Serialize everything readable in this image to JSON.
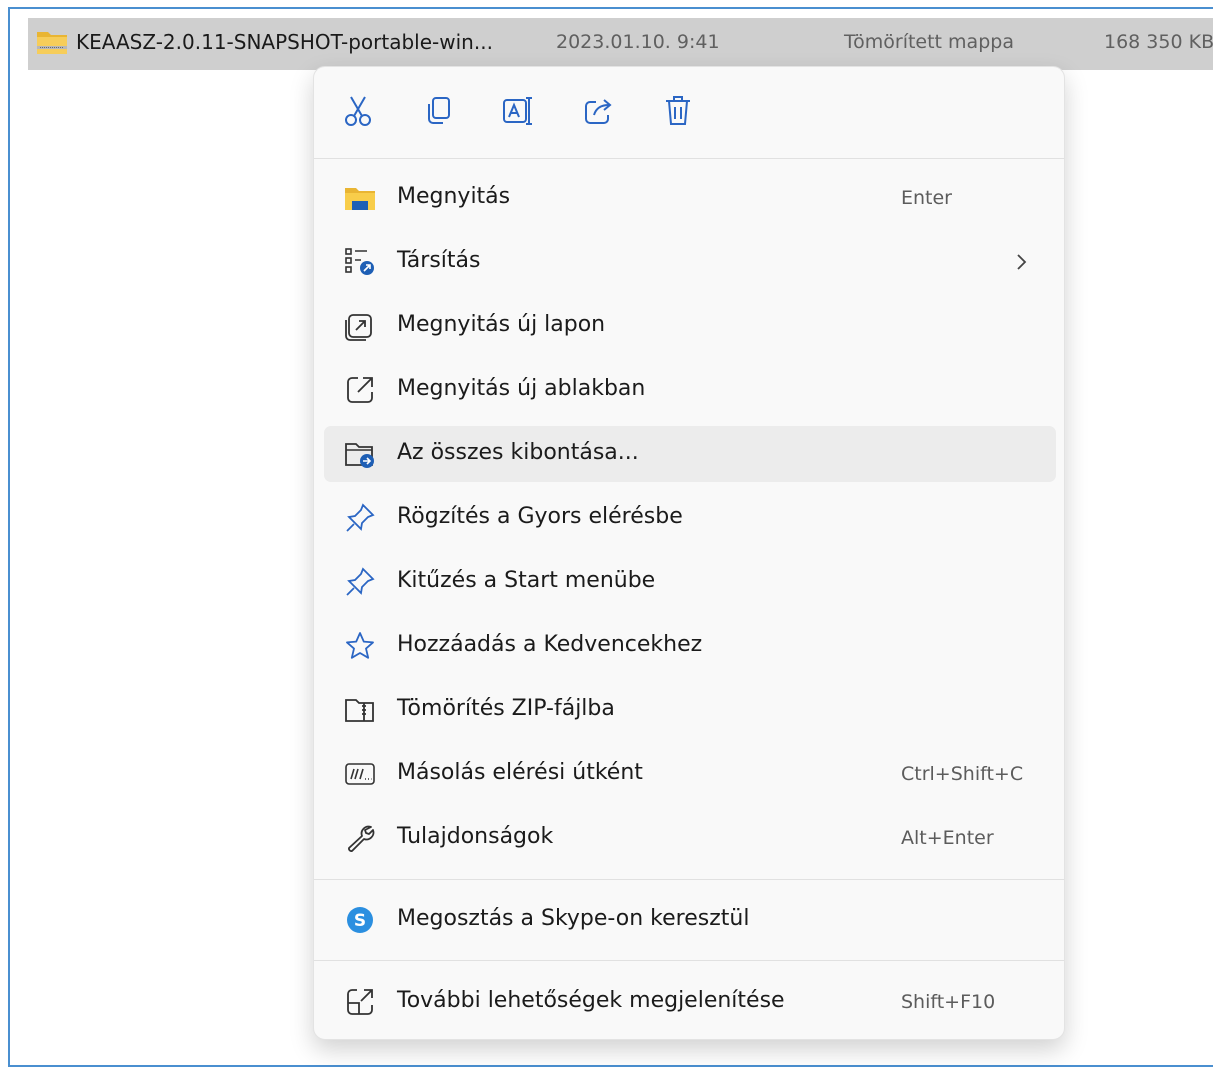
{
  "file": {
    "name": "KEAASZ-2.0.11-SNAPSHOT-portable-win...",
    "date": "2023.01.10. 9:41",
    "type": "Tömörített mappa",
    "size": "168 350 KB",
    "icon": "zip-folder-icon"
  },
  "menu": {
    "quick_actions": [
      {
        "name": "cut",
        "icon": "scissors-icon"
      },
      {
        "name": "copy",
        "icon": "copy-icon"
      },
      {
        "name": "rename",
        "icon": "rename-icon"
      },
      {
        "name": "share",
        "icon": "share-icon"
      },
      {
        "name": "delete",
        "icon": "trash-icon"
      }
    ],
    "items": [
      {
        "label": "Megnyitás",
        "shortcut": "Enter",
        "icon": "folder-open-icon"
      },
      {
        "label": "Társítás",
        "shortcut": "",
        "icon": "open-with-icon",
        "has_submenu": true
      },
      {
        "label": "Megnyitás új lapon",
        "shortcut": "",
        "icon": "new-tab-icon"
      },
      {
        "label": "Megnyitás új ablakban",
        "shortcut": "",
        "icon": "new-window-icon"
      },
      {
        "label": "Az összes kibontása...",
        "shortcut": "",
        "icon": "extract-all-icon",
        "highlighted": true
      },
      {
        "label": "Rögzítés a Gyors elérésbe",
        "shortcut": "",
        "icon": "pin-icon"
      },
      {
        "label": "Kitűzés a Start menübe",
        "shortcut": "",
        "icon": "pin-start-icon"
      },
      {
        "label": "Hozzáadás a Kedvencekhez",
        "shortcut": "",
        "icon": "star-icon"
      },
      {
        "label": "Tömörítés ZIP-fájlba",
        "shortcut": "",
        "icon": "zip-icon"
      },
      {
        "label": "Másolás elérési útként",
        "shortcut": "Ctrl+Shift+C",
        "icon": "copy-path-icon"
      },
      {
        "label": "Tulajdonságok",
        "shortcut": "Alt+Enter",
        "icon": "wrench-icon"
      },
      {
        "label": "Megosztás a Skype-on keresztül",
        "shortcut": "",
        "icon": "skype-icon"
      },
      {
        "label": "További lehetőségek megjelenítése",
        "shortcut": "Shift+F10",
        "icon": "more-options-icon"
      }
    ]
  },
  "colors": {
    "accent": "#2b66c4",
    "selection": "#cfcfcf",
    "frame": "#4a8fd0",
    "hover": "#ececec"
  }
}
